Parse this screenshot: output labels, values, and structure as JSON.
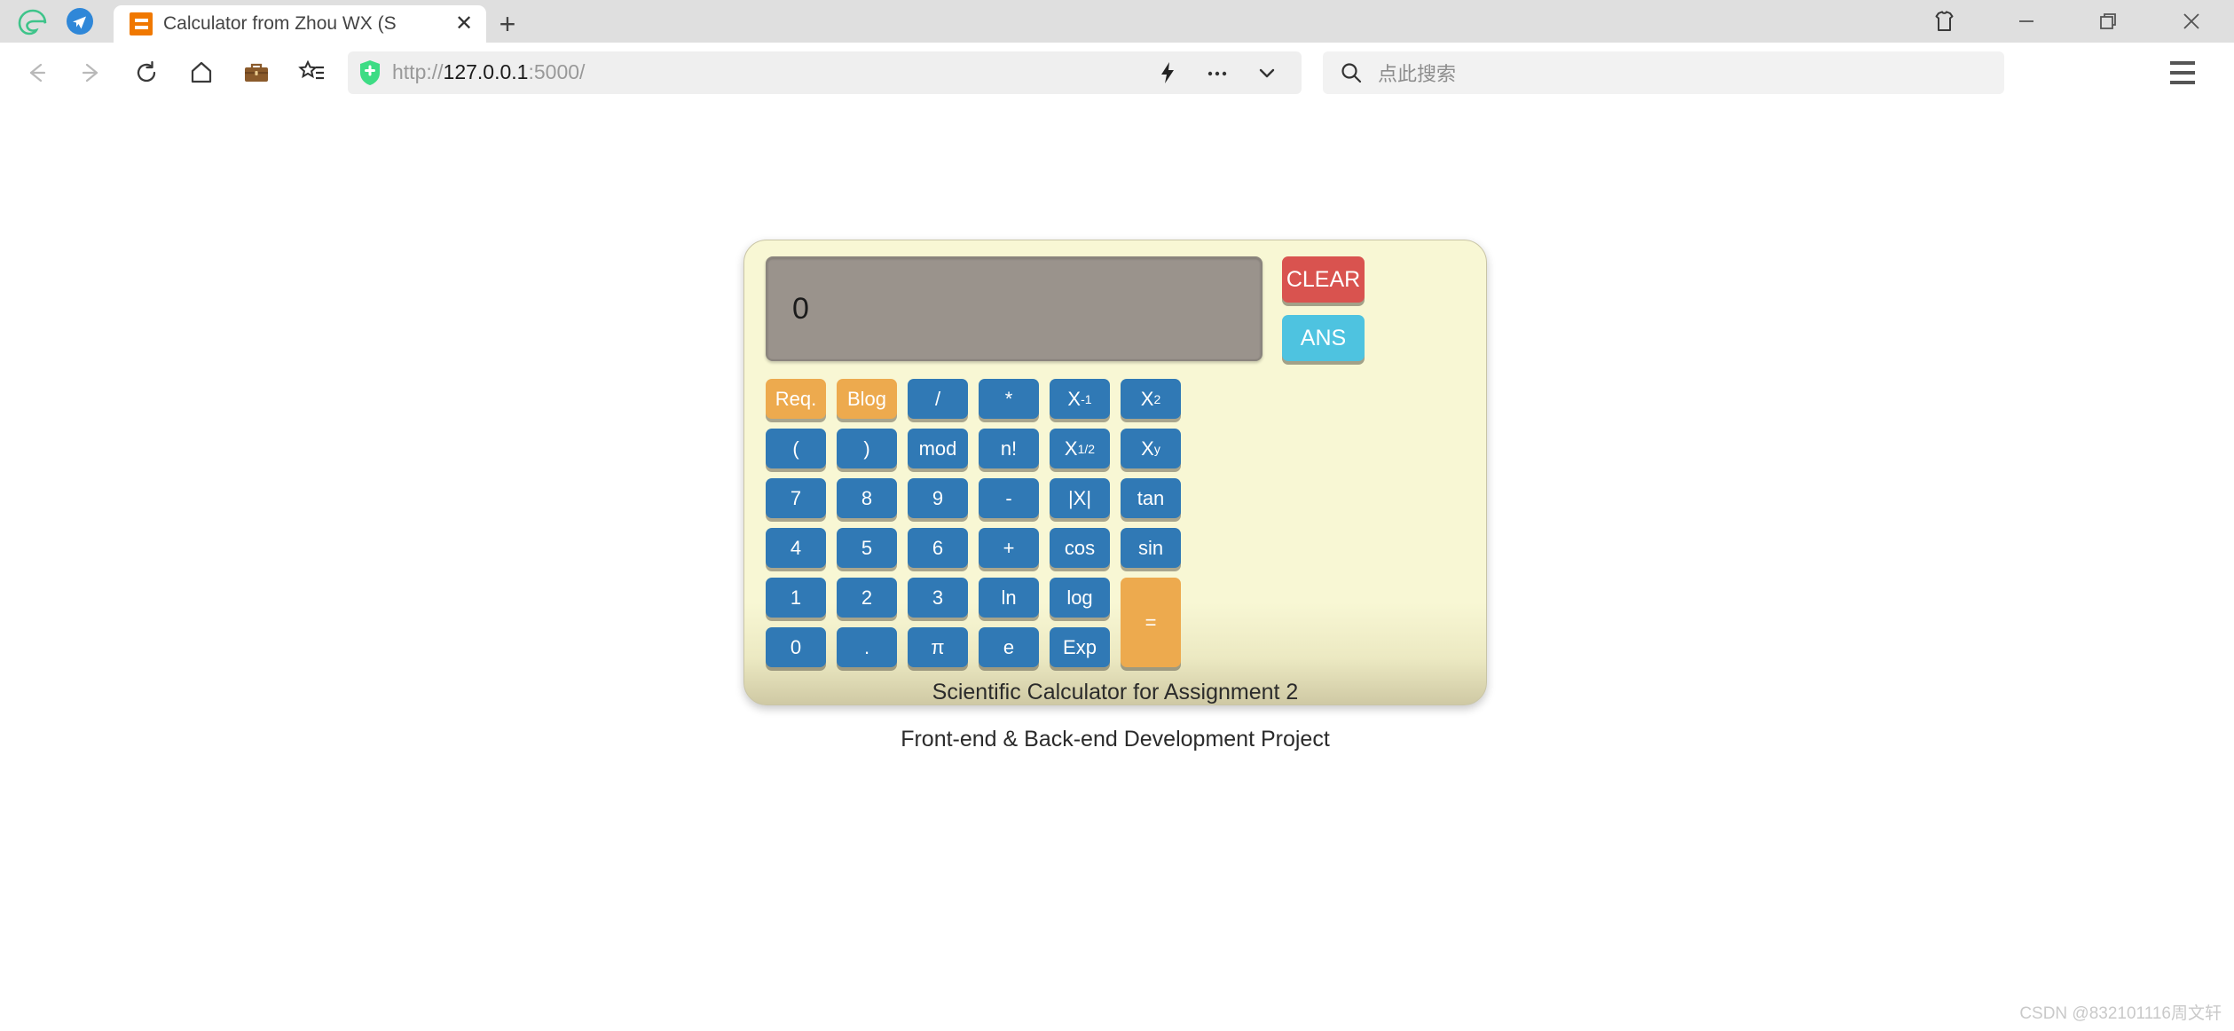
{
  "window": {
    "controls": [
      {
        "name": "theme-skin-button",
        "icon": "tshirt-icon",
        "label": ""
      },
      {
        "name": "minimize-button",
        "icon": "minimize-icon",
        "label": ""
      },
      {
        "name": "maximize-button",
        "icon": "restore-icon",
        "label": ""
      },
      {
        "name": "close-button",
        "icon": "close-icon",
        "label": ""
      }
    ]
  },
  "tabstrip": {
    "tab_title": "Calculator from Zhou WX (S",
    "close_glyph": "✕",
    "new_tab_glyph": "+"
  },
  "toolbar": {
    "back_glyph": "←",
    "forward_glyph": "→",
    "reload_glyph": "⟳",
    "home_label": "home-icon",
    "collections_label": "briefcase-icon",
    "favorites_label": "favorites-icon",
    "url": {
      "scheme": "http://",
      "host": "127.0.0.1",
      "port_path": ":5000/",
      "full": "http://127.0.0.1:5000/"
    },
    "actions": [
      {
        "name": "lightning-icon",
        "glyph": "⚡"
      },
      {
        "name": "more-options-icon",
        "glyph": "…"
      },
      {
        "name": "chevron-down-icon",
        "glyph": "∨"
      }
    ],
    "search": {
      "placeholder": "点此搜索",
      "icon": "search-icon"
    },
    "menu_icon": "hamburger-menu-icon"
  },
  "calculator": {
    "display_value": "0",
    "side_buttons": [
      {
        "label": "CLEAR",
        "name": "clear-button",
        "color": "#d9534f"
      },
      {
        "label": "ANS",
        "name": "ans-button",
        "color": "#4ec3e0"
      }
    ],
    "keys": [
      {
        "label": "Req.",
        "name": "key-req",
        "style": "orange"
      },
      {
        "label": "Blog",
        "name": "key-blog",
        "style": "orange"
      },
      {
        "label": "/",
        "name": "key-divide",
        "style": "blue"
      },
      {
        "label": "*",
        "name": "key-multiply",
        "style": "blue"
      },
      {
        "label": "X",
        "sup": "-1",
        "name": "key-inverse",
        "style": "blue"
      },
      {
        "label": "X",
        "sup": "2",
        "name": "key-square",
        "style": "blue"
      },
      {
        "label": "(",
        "name": "key-open-paren",
        "style": "blue"
      },
      {
        "label": ")",
        "name": "key-close-paren",
        "style": "blue"
      },
      {
        "label": "mod",
        "name": "key-mod",
        "style": "blue"
      },
      {
        "label": "n!",
        "name": "key-factorial",
        "style": "blue"
      },
      {
        "label": "X",
        "sup": "1/2",
        "name": "key-sqrt",
        "style": "blue"
      },
      {
        "label": "X",
        "sup": "y",
        "name": "key-power",
        "style": "blue"
      },
      {
        "label": "7",
        "name": "key-7",
        "style": "blue"
      },
      {
        "label": "8",
        "name": "key-8",
        "style": "blue"
      },
      {
        "label": "9",
        "name": "key-9",
        "style": "blue"
      },
      {
        "label": "-",
        "name": "key-minus",
        "style": "blue"
      },
      {
        "label": "|X|",
        "name": "key-abs",
        "style": "blue"
      },
      {
        "label": "tan",
        "name": "key-tan",
        "style": "blue"
      },
      {
        "label": "4",
        "name": "key-4",
        "style": "blue"
      },
      {
        "label": "5",
        "name": "key-5",
        "style": "blue"
      },
      {
        "label": "6",
        "name": "key-6",
        "style": "blue"
      },
      {
        "label": "+",
        "name": "key-plus",
        "style": "blue"
      },
      {
        "label": "cos",
        "name": "key-cos",
        "style": "blue"
      },
      {
        "label": "sin",
        "name": "key-sin",
        "style": "blue"
      },
      {
        "label": "1",
        "name": "key-1",
        "style": "blue"
      },
      {
        "label": "2",
        "name": "key-2",
        "style": "blue"
      },
      {
        "label": "3",
        "name": "key-3",
        "style": "blue"
      },
      {
        "label": "ln",
        "name": "key-ln",
        "style": "blue"
      },
      {
        "label": "log",
        "name": "key-log",
        "style": "blue"
      },
      {
        "label": "=",
        "name": "key-equals",
        "style": "orange-eq"
      },
      {
        "label": "0",
        "name": "key-0",
        "style": "blue"
      },
      {
        "label": ".",
        "name": "key-decimal",
        "style": "blue"
      },
      {
        "label": "π",
        "name": "key-pi",
        "style": "blue"
      },
      {
        "label": "e",
        "name": "key-e",
        "style": "blue"
      },
      {
        "label": "Exp",
        "name": "key-exp",
        "style": "blue"
      }
    ],
    "footer_line1": "Scientific Calculator for Assignment 2",
    "footer_line2": "Front-end & Back-end Development Project"
  },
  "watermark": "CSDN @832101116周文轩"
}
